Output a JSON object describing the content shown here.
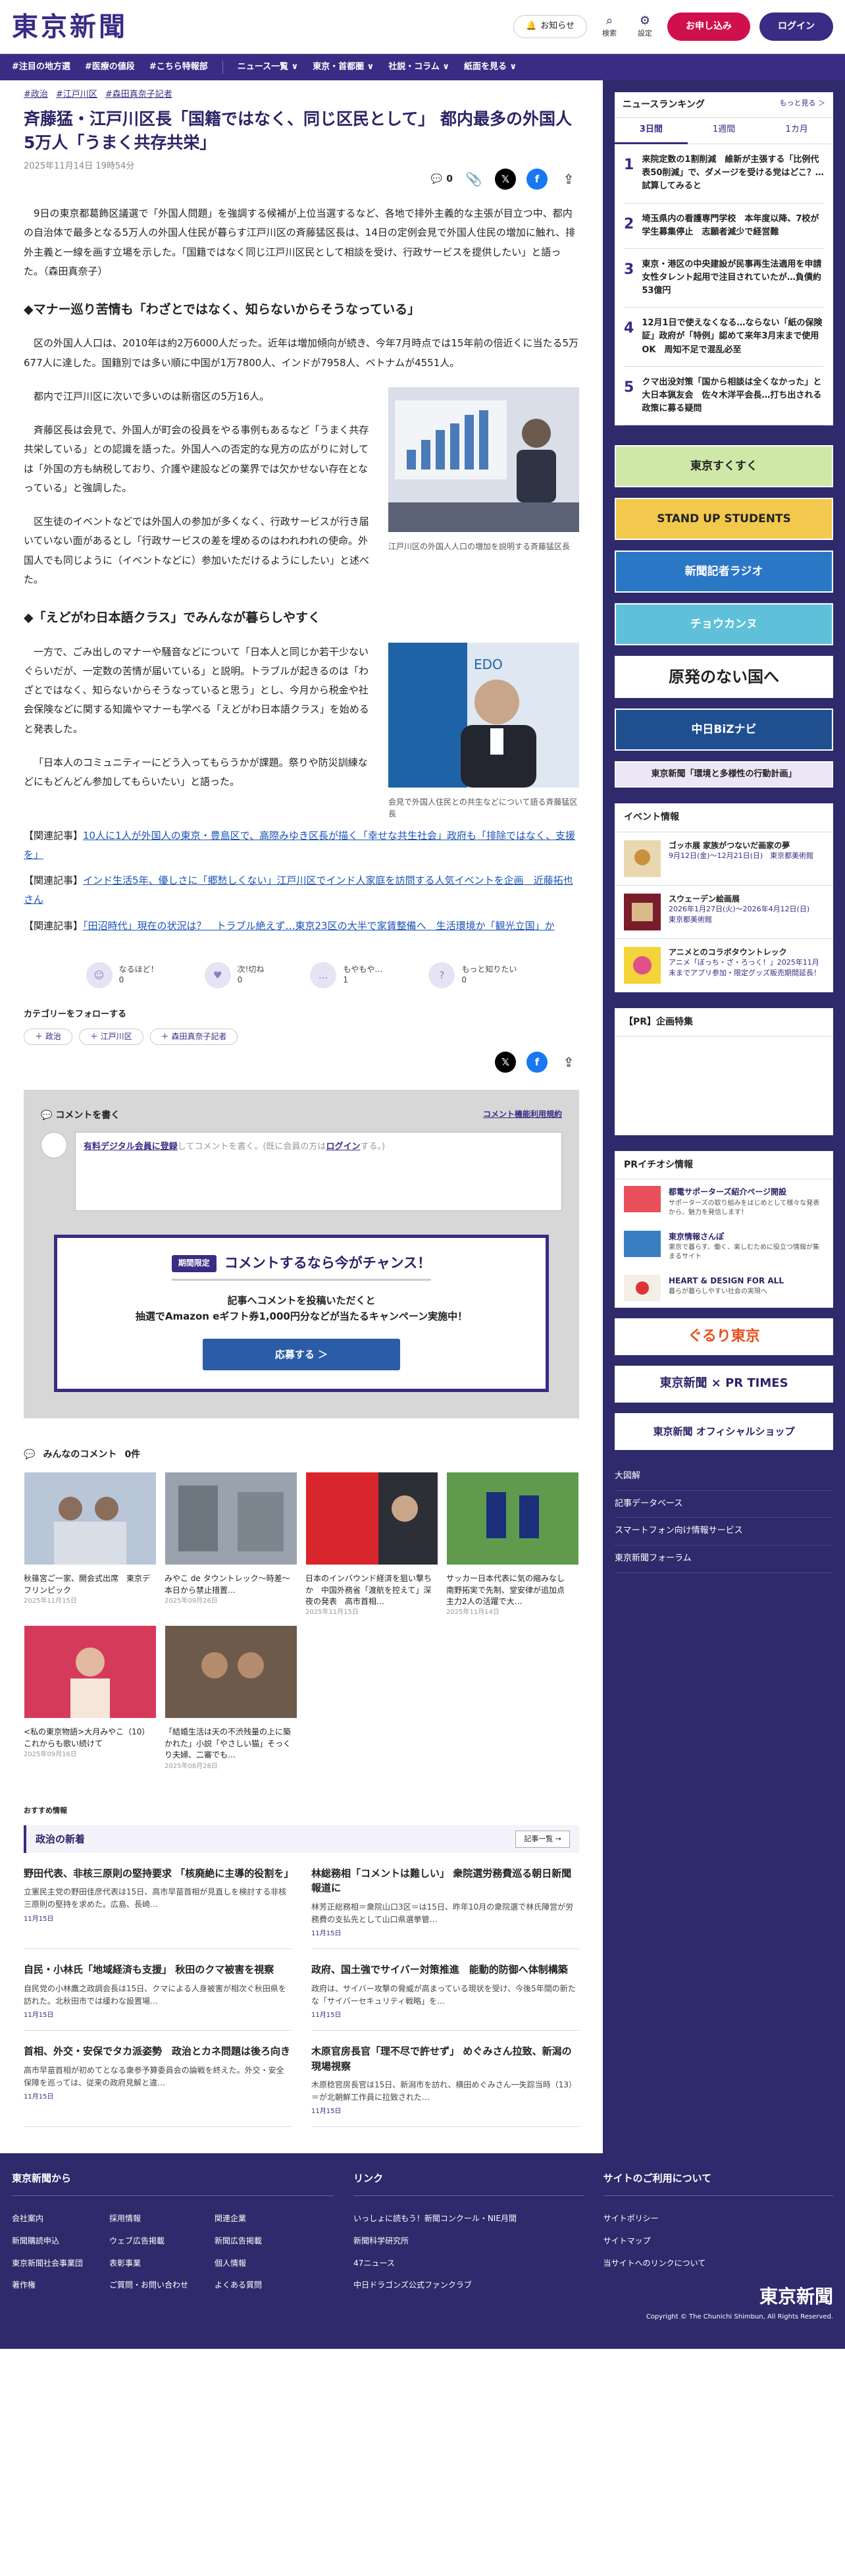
{
  "header": {
    "logo": "東京新聞",
    "notice": "お知らせ",
    "search": "検索",
    "settings": "設定",
    "subscribe": "お申し込み",
    "login": "ログイン"
  },
  "nav": [
    "#注目の地方選",
    "#医療の値段",
    "#こちら特報部",
    "ニュース一覧 ∨",
    "東京・首都圏 ∨",
    "社説・コラム ∨",
    "紙面を見る ∨"
  ],
  "article": {
    "tags": [
      "#政治",
      "#江戸川区",
      "#森田真奈子記者"
    ],
    "title": "斉藤猛・江戸川区長「国籍ではなく、同じ区民として」 都内最多の外国人5万人「うまく共存共栄」",
    "date": "2025年11月14日 19時54分",
    "comment_count": "0",
    "p1": "9日の東京都葛飾区議選で「外国人問題」を強調する候補が上位当選するなど、各地で排外主義的な主張が目立つ中、都内の自治体で最多となる5万人の外国人住民が暮らす江戸川区の斉藤猛区長は、14日の定例会見で外国人住民の増加に触れ、排外主義と一線を画す立場を示した。「国籍ではなく同じ江戸川区民として相談を受け、行政サービスを提供したい」と語った。（森田真奈子）",
    "h1": "◆マナー巡り苦情も「わざとではなく、知らないからそうなっている」",
    "p2": "区の外国人人口は、2010年は約2万6000人だった。近年は増加傾向が続き、今年7月時点では15年前の倍近くに当たる5万677人に達した。国籍別では多い順に中国が1万7800人、インドが7958人、ベトナムが4551人。",
    "p3": "都内で江戸川区に次いで多いのは新宿区の5万16人。",
    "p4": "斉藤区長は会見で、外国人が町会の役員をやる事例もあるなど「うまく共存共栄している」との認識を語った。外国人への否定的な見方の広がりに対しては「外国の方も納税しており、介護や建設などの業界では欠かせない存在となっている」と強調した。",
    "p5": "区生徒のイベントなどでは外国人の参加が多くなく、行政サービスが行き届いていない面があるとし「行政サービスの差を埋めるのはわれわれの使命。外国人でも同じように（イベントなどに）参加いただけるようにしたい」と述べた。",
    "fig1_cap": "江戸川区の外国人人口の増加を説明する斉藤猛区長",
    "h2": "◆「えどがわ日本語クラス」でみんなが暮らしやすく",
    "p6": "一方で、ごみ出しのマナーや騒音などについて「日本人と同じか若干少ないぐらいだが、一定数の苦情が届いている」と説明。トラブルが起きるのは「わざとではなく、知らないからそうなっていると思う」とし、今月から税金や社会保険などに関する知識やマナーも学べる「えどがわ日本語クラス」を始めると発表した。",
    "p7": "「日本人のコミュニティーにどう入ってもらうかが課題。祭りや防災訓練などにもどんどん参加してもらいたい」と語った。",
    "fig2_cap": "会見で外国人住民との共生などについて語る斉藤猛区長",
    "related": [
      {
        "pre": "【関連記事】",
        "link": "10人に1人が外国人の東京・豊島区で、高際みゆき区長が描く「幸せな共生社会」政府も「排除ではなく、支援を」"
      },
      {
        "pre": "【関連記事】",
        "link": "インド生活5年、優しさに「郷愁しくない」江戸川区でインド人家庭を訪問する人気イベントを企画　近藤拓也さん"
      },
      {
        "pre": "【関連記事】",
        "link": "「田沼時代」現在の状況は？　トラブル絶えず…東京23区の大半で家賃整備へ　生活環境か「観光立国」か"
      }
    ]
  },
  "reactions": [
    {
      "label": "なるほど！",
      "count": "0"
    },
    {
      "label": "次!切ね",
      "count": "0"
    },
    {
      "label": "もやもや…",
      "count": "1"
    },
    {
      "label": "もっと知りたい",
      "count": "0"
    }
  ],
  "category": {
    "heading": "カテゴリーをフォローする",
    "tags": [
      "＋ 政治",
      "＋ 江戸川区",
      "＋ 森田真奈子記者"
    ]
  },
  "comment": {
    "write": "コメントを書く",
    "rules": "コメント機能利用規約",
    "placeholder_a": "有料デジタル会員に登録",
    "placeholder_b": "してコメントを書く。(既に会員の方は",
    "placeholder_c": "ログイン",
    "placeholder_d": "する。)"
  },
  "promo": {
    "limited": "期間限定",
    "title": "コメントするなら今がチャンス！",
    "line1": "記事へコメントを投稿いただくと",
    "line2": "抽選でAmazon eギフト券1,000円分などが当たるキャンペーン実施中！",
    "apply": "応募する ＞"
  },
  "mycomments": {
    "title": "みんなのコメント",
    "count": "0件"
  },
  "grid": [
    {
      "t": "秋篠宮ご一家、開会式出席　東京デフリンピック",
      "d": "2025年11月15日"
    },
    {
      "t": "みやこ de タウントレック〜時差〜 本日から禁止措置…",
      "d": "2025年09月26日"
    },
    {
      "t": "日本のインバウンド経済を狙い撃ちか　中国外務省「渡航を控えて」深夜の発表　高市首相…",
      "d": "2025年11月15日"
    },
    {
      "t": "サッカー日本代表に気の縮みなし　南野拓実で先制、堂安律が追加点　主力2人の活躍で大…",
      "d": "2025年11月14日"
    },
    {
      "t": "<私の東京物語>大月みやこ（10）これからも歌い続けて",
      "d": "2025年09月16日"
    },
    {
      "t": "「結婚生活は天の不渋残量の上に築かれた」小説「やさしい猫」そっくり夫婦、二審でも…",
      "d": "2025年08月28日"
    }
  ],
  "recommend": {
    "label": "おすすめ情報",
    "section": "政治の新着",
    "more": "記事一覧 →"
  },
  "news": [
    {
      "h": "野田代表、非核三原則の堅持要求 「核廃絶に主導的役割を」",
      "p": "立憲民主党の野田佳彦代表は15日、高市早苗首相が見直しを検討する非核三原則の堅持を求めた。広島、長崎…",
      "d": "11月15日"
    },
    {
      "h": "林総務相「コメントは難しい」 衆院選労務費巡る朝日新聞報道に",
      "p": "林芳正総務相＝衆院山口3区＝は15日、昨年10月の衆院選で林氏陣営が労務費の支払先として山口県選挙管…",
      "d": "11月15日"
    },
    {
      "h": "自民・小林氏「地域経済も支援」 秋田のクマ被害を視察",
      "p": "自民党の小林鷹之政調会長は15日、クマによる人身被害が相次ぐ秋田県を訪れた。北秋田市では緩わな設置場…",
      "d": "11月15日"
    },
    {
      "h": "政府、国土強でサイバー対策推進　能動的防御へ体制構築",
      "p": "政府は、サイバー攻撃の脅威が高まっている現状を受け、今後5年間の新たな「サイバーセキュリティ戦略」を…",
      "d": "11月15日"
    },
    {
      "h": "首相、外交・安保でタカ派姿勢　政治とカネ問題は後ろ向き",
      "p": "高市早苗首相が初めてとなる衆参予算委員会の論戦を終えた。外交・安全保障を巡っては、従来の政府見解と違…",
      "d": "11月15日"
    },
    {
      "h": "木原官房長官「理不尽で許せず」 めぐみさん拉致、新潟の現場視察",
      "p": "木原稔官房長官は15日、新潟市を訪れ、横田めぐみさん一失踪当時（13）＝が北朝鮮工作員に拉致された…",
      "d": "11月15日"
    }
  ],
  "ranking": {
    "title": "ニュースランキング",
    "more": "もっと見る ＞",
    "tabs": [
      "3日間",
      "1週間",
      "1カ月"
    ],
    "items": [
      {
        "n": "1",
        "t": "来院定数の1割削減　維新が主張する「比例代表50削減」で、ダメージを受ける党はどこ？…試算してみると"
      },
      {
        "n": "2",
        "t": "埼玉県内の看護専門学校　本年度以降、7校が学生募集停止　志願者減少で経営難"
      },
      {
        "n": "3",
        "t": "東京・港区の中央建設が民事再生法適用を申請　女性タレント起用で注目されていたが…負債約53億円"
      },
      {
        "n": "4",
        "t": "12月1日で使えなくなる…ならない「紙の保険証」政府が「特例」認めて来年3月末まで使用OK　周知不足で混乱必至"
      },
      {
        "n": "5",
        "t": "クマ出没対策「国から相談は全くなかった」と大日本猟友会　佐々木洋平会長…打ち出される政策に募る疑問"
      }
    ]
  },
  "banners": [
    {
      "text": "東京すくすく",
      "bg": "#cfe8a8"
    },
    {
      "text": "STAND UP STUDENTS",
      "bg": "#f2c94c"
    },
    {
      "text": "新聞記者ラジオ",
      "bg": "#2a78c5"
    },
    {
      "text": "チョウカンヌ",
      "bg": "#5ec1d9"
    },
    {
      "text": "原発のない国へ",
      "bg": "#ffffff"
    },
    {
      "text": "中日BiZナビ",
      "bg": "#1f4f8f"
    },
    {
      "text": "東京新聞「環境と多様性の行動計画」",
      "bg": "#ece6f6"
    }
  ],
  "events": {
    "title": "イベント情報",
    "items": [
      {
        "t": "ゴッホ展 家族がつないだ画家の夢",
        "d": "9月12日(金)〜12月21日(日)　東京都美術館"
      },
      {
        "t": "スウェーデン絵画展",
        "d": "2026年1月27日(火)〜2026年4月12日(日)　東京都美術館"
      },
      {
        "t": "アニメとのコラボタウントレック",
        "d": "アニメ「ぼっち・ざ・ろっく！」2025年11月末までアプリ参加・限定グッズ販売期間延長！"
      }
    ]
  },
  "pr": {
    "title": "【PR】企画特集"
  },
  "prinfo": {
    "title": "PRイチオシ情報",
    "items": [
      {
        "t": "都電サポーターズ紹介ページ開設",
        "d": "サポーターズの取り組みをはじめとして様々な発表から、魅力を発信します！"
      },
      {
        "t": "東京情報さんぽ",
        "d": "東京で暮らす、働く、楽しむために役立つ情報が集まるサイト"
      },
      {
        "t": "HEART & DESIGN FOR ALL",
        "d": "暮らが暮らしやすい社会の実現へ"
      }
    ]
  },
  "logos": [
    "ぐるり東京",
    "東京新聞 × PR TIMES",
    "東京新聞 オフィシャルショップ"
  ],
  "side_links": [
    "大図解",
    "記事データベース",
    "スマートフォン向け情報サービス",
    "東京新聞フォーラム"
  ],
  "footer": {
    "c1": "東京新聞から",
    "c2": "リンク",
    "c3": "サイトのご利用について",
    "c1a": [
      "会社案内",
      "採用情報",
      "関連企業"
    ],
    "c1b": [
      "新聞購読申込",
      "ウェブ広告掲載",
      "新聞広告掲載"
    ],
    "c1c": [
      "東京新聞社会事業団",
      "表彰事業",
      "個人情報"
    ],
    "c1d": [
      "著作権",
      "ご質問・お問い合わせ",
      "よくある質問"
    ],
    "c2a": [
      "いっしょに読もう！新聞コンクール・NIE月間",
      "新聞科学研究所",
      "47ニュース",
      "中日ドラゴンズ公式ファンクラブ"
    ],
    "c3a": [
      "サイトポリシー",
      "サイトマップ",
      "当サイトへのリンクについて"
    ],
    "logo": "東京新聞",
    "copy": "Copyright © The Chunichi Shimbun, All Rights Reserved."
  }
}
